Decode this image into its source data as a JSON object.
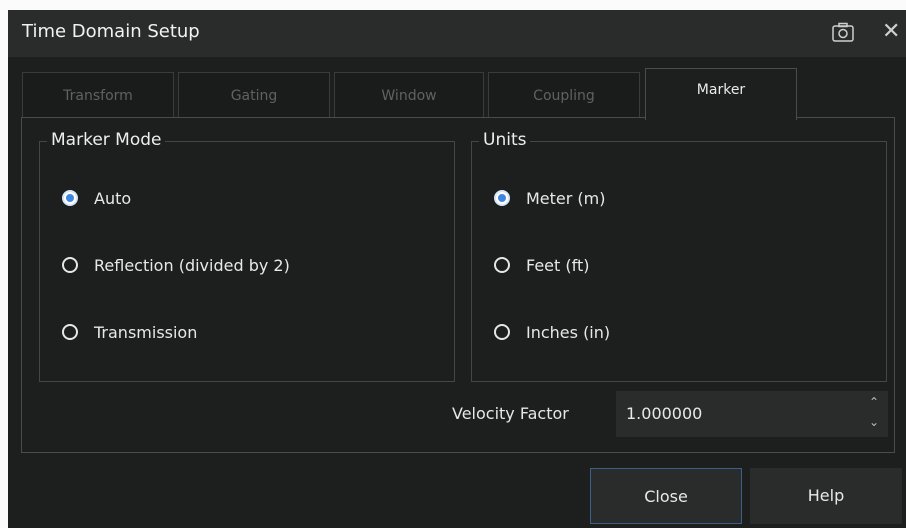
{
  "window": {
    "title": "Time Domain Setup",
    "close_glyph": "✕",
    "icons": [
      "camera-icon",
      "close-icon"
    ]
  },
  "tabs": [
    {
      "label": "Transform",
      "active": false
    },
    {
      "label": "Gating",
      "active": false
    },
    {
      "label": "Window",
      "active": false
    },
    {
      "label": "Coupling",
      "active": false
    },
    {
      "label": "Marker",
      "active": true
    }
  ],
  "marker_mode": {
    "title": "Marker Mode",
    "options": [
      {
        "label": "Auto",
        "checked": true
      },
      {
        "label": "Reflection (divided by 2)",
        "checked": false
      },
      {
        "label": "Transmission",
        "checked": false
      }
    ]
  },
  "units": {
    "title": "Units",
    "options": [
      {
        "label": "Meter (m)",
        "checked": true
      },
      {
        "label": "Feet (ft)",
        "checked": false
      },
      {
        "label": "Inches (in)",
        "checked": false
      }
    ]
  },
  "velocity_factor": {
    "label": "Velocity Factor",
    "value": "1.000000"
  },
  "buttons": {
    "close": "Close",
    "help": "Help"
  },
  "colors": {
    "background": "#1c1f1d",
    "titlebar": "#2a2b2b",
    "radio_accent": "#3f86e2",
    "close_button_border": "#3b5f8a"
  }
}
